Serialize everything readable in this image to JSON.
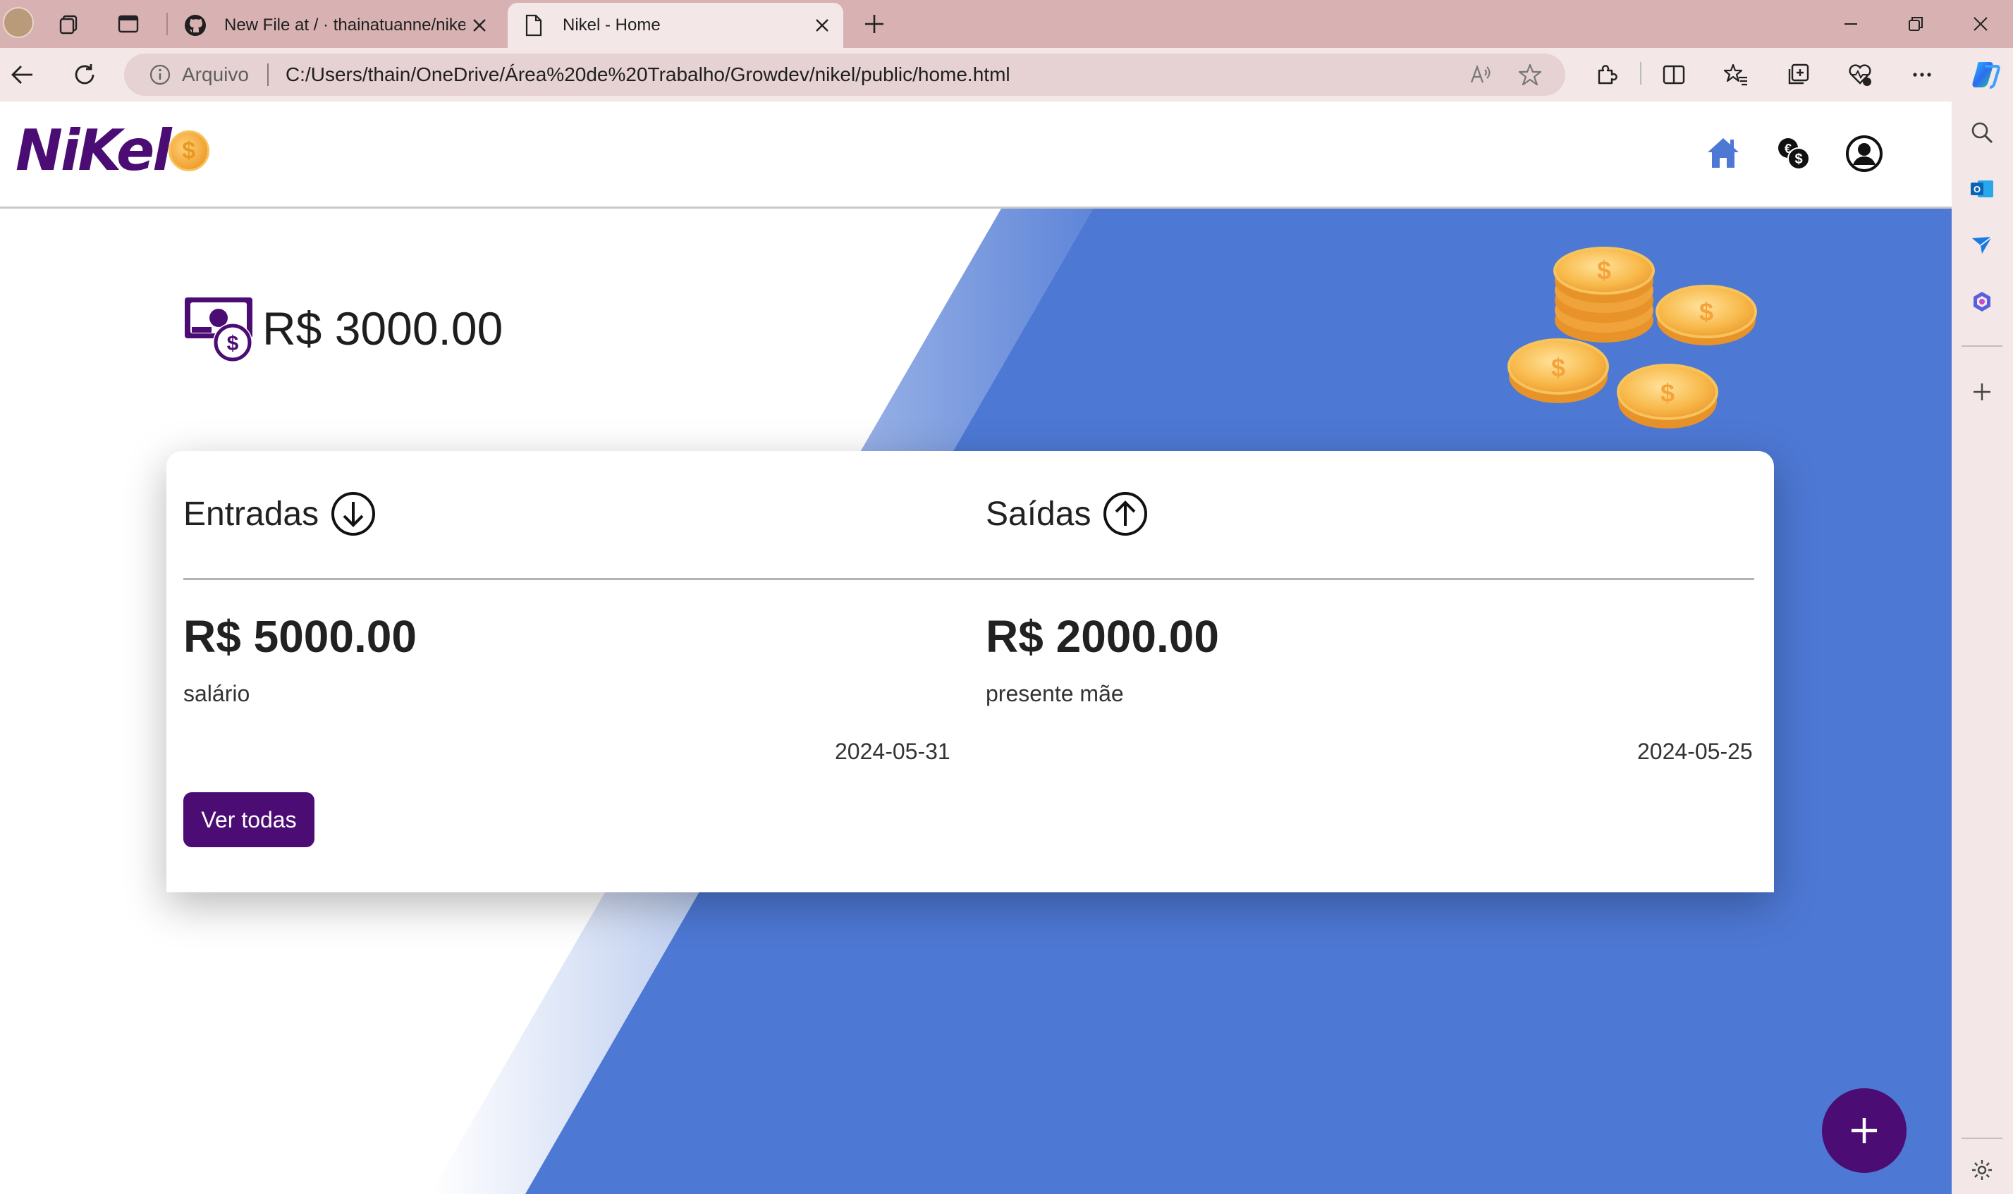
{
  "browser": {
    "tabs": [
      {
        "title": "New File at / · thainatuanne/nikel",
        "active": false
      },
      {
        "title": "Nikel - Home",
        "active": true
      }
    ],
    "address_label": "Arquivo",
    "url": "C:/Users/thain/OneDrive/Área%20de%20Trabalho/Growdev/nikel/public/home.html"
  },
  "app": {
    "logo_text": "NiKel",
    "logo_coin_symbol": "$",
    "nav_icons": [
      "home-icon",
      "transactions-icon",
      "profile-icon"
    ],
    "brand_color": "#4b0c73",
    "accent_blue": "#4d78d4"
  },
  "balance": {
    "text": "R$ 3000.00"
  },
  "entradas": {
    "title": "Entradas",
    "amount": "R$ 5000.00",
    "description": "salário",
    "date": "2024-05-31"
  },
  "saidas": {
    "title": "Saídas",
    "amount": "R$ 2000.00",
    "description": "presente mãe",
    "date": "2024-05-25"
  },
  "actions": {
    "ver_todas": "Ver todas",
    "add_symbol": "+"
  }
}
